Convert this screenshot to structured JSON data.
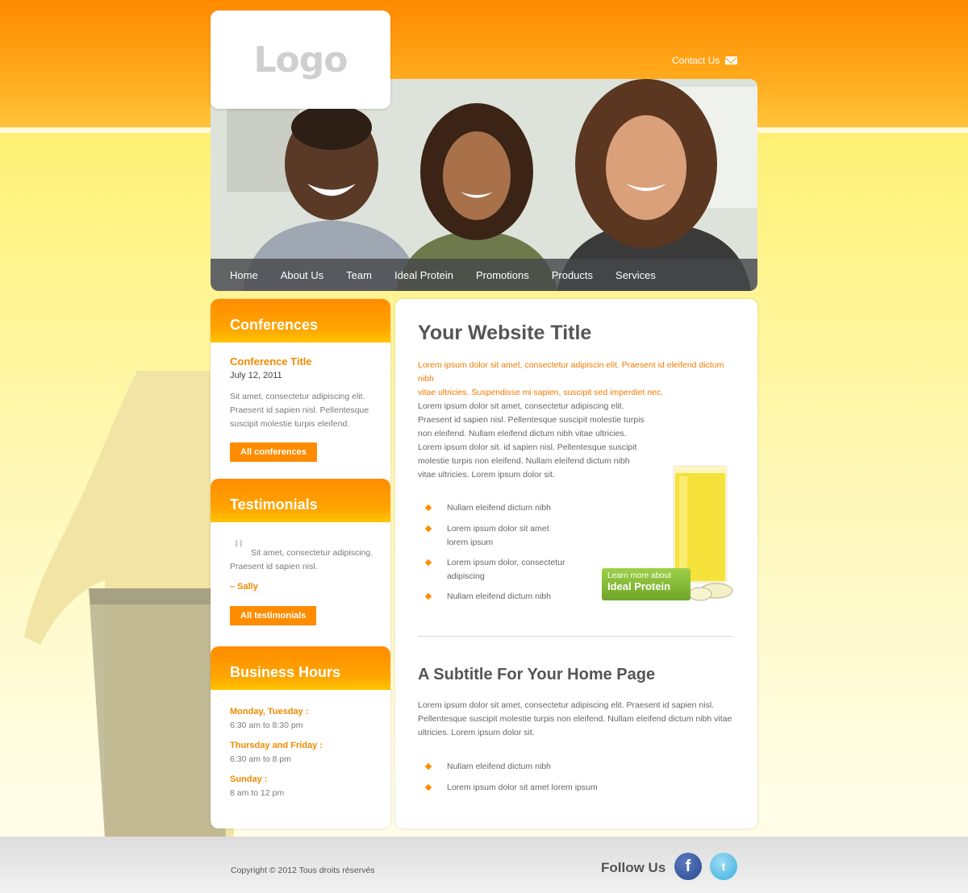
{
  "colors": {
    "accent": "#ff8c00",
    "header_orange": "#ff8a00",
    "promo_green": "#8cc63f"
  },
  "header": {
    "logo": "Logo",
    "contact_label": "Contact Us",
    "contact_icon": "envelope-icon"
  },
  "nav": {
    "items": [
      {
        "label": "Home"
      },
      {
        "label": "About Us"
      },
      {
        "label": "Team"
      },
      {
        "label": "Ideal Protein"
      },
      {
        "label": "Promotions"
      },
      {
        "label": "Products"
      },
      {
        "label": "Services"
      }
    ]
  },
  "sidebar": {
    "conferences": {
      "heading": "Conferences",
      "title": "Conference Title",
      "date": "July 12, 2011",
      "text_lines": [
        "Sit amet, consectetur adipiscing elit.",
        "Praesent id sapien nisl. Pellentesque",
        "suscipit molestie turpis eleifend."
      ],
      "button": "All conferences"
    },
    "testimonials": {
      "heading": "Testimonials",
      "quote_lines": [
        "Sit amet, consectetur adipiscing.",
        "Praesent id sapien nisl."
      ],
      "author": "– Sally",
      "button": "All testimonials"
    },
    "hours": {
      "heading": "Business Hours",
      "entries": [
        {
          "days": "Monday, Tuesday :",
          "time": "6:30 am to 8:30 pm"
        },
        {
          "days": "Thursday and Friday :",
          "time": "6:30 am to 8 pm"
        },
        {
          "days": "Sunday :",
          "time": "8 am to 12 pm"
        }
      ]
    }
  },
  "main": {
    "title": "Your Website Title",
    "lead_lines": [
      "Lorem ipsum dolor sit amet, consectetur adipiscin elit. Praesent id eleifend dictum nibh",
      "vitae ultricies. Suspendisse mi sapien, suscipit sed imperdiet nec."
    ],
    "body_lines": [
      "Lorem ipsum dolor sit amet, consectetur adipiscing elit.",
      "Praesent id sapien nisl. Pellentesque suscipit molestie turpis",
      "non eleifend. Nullam eleifend dictum nibh vitae ultricies.",
      "Lorem ipsum dolor sit. id sapien nisl. Pellentesque suscipit",
      "molestie turpis non eleifend. Nullam eleifend dictum nibh",
      "vitae ultricies. Lorem ipsum dolor sit."
    ],
    "bullets": [
      [
        "Nullam eleifend dictum nibh"
      ],
      [
        "Lorem ipsum dolor sit amet",
        "lorem ipsum"
      ],
      [
        "Lorem ipsum dolor, consectetur",
        "adipiscing"
      ],
      [
        "Nullam eleifend dictum nibh"
      ]
    ],
    "promo": {
      "line1": "Learn more about",
      "line2": "Ideal Protein"
    },
    "subtitle": "A Subtitle For Your Home Page",
    "sub_lines": [
      "Lorem ipsum dolor sit amet, consectetur adipiscing elit. Praesent id sapien nisl.",
      "Pellentesque suscipit molestie turpis non eleifend. Nullam eleifend dictum nibh vitae",
      "ultricies. Lorem ipsum dolor sit."
    ],
    "sub_bullets": [
      "Nullam eleifend dictum nibh",
      "Lorem ipsum dolor sit amet lorem ipsum"
    ]
  },
  "footer": {
    "copyright": "Copyright © 2012 Tous droits réservés",
    "follow": "Follow Us",
    "facebook_glyph": "f",
    "twitter_glyph": "t"
  }
}
